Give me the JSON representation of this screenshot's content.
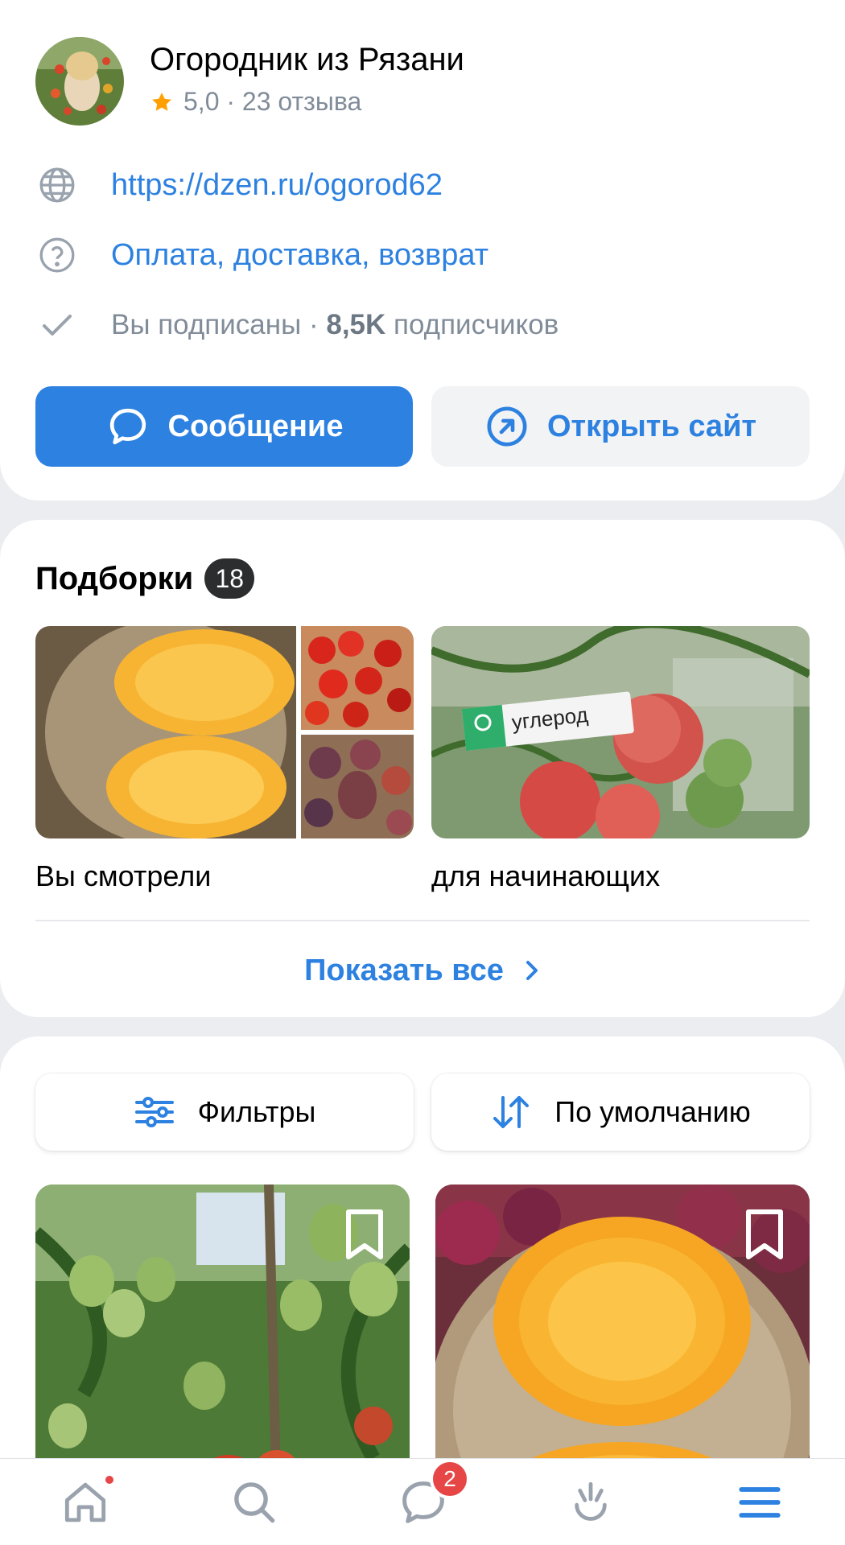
{
  "colors": {
    "accent": "#2D81E0",
    "muted_text": "#818C99",
    "background": "#EBEDF0",
    "badge_red": "#E64646",
    "icon_gray": "#99A2AD"
  },
  "profile": {
    "name": "Огородник из Рязани",
    "rating": "5,0",
    "rating_sep": " · ",
    "reviews": "23 отзыва"
  },
  "info": {
    "website": "https://dzen.ru/ogorod62",
    "policy": "Оплата, доставка, возврат",
    "subscribed": "Вы подписаны",
    "sep": " · ",
    "subscribers_count": "8,5K",
    "subscribers_word": " подписчиков"
  },
  "actions": {
    "message": "Сообщение",
    "open_site": "Открыть сайт"
  },
  "collections": {
    "title": "Подборки",
    "count": "18",
    "items": [
      {
        "label": "Вы смотрели"
      },
      {
        "label": "для начинающих",
        "overlay_tag": "углерод"
      }
    ],
    "show_all": "Показать все"
  },
  "products": {
    "filters_label": "Фильтры",
    "sort_label": "По умолчанию"
  },
  "tabbar": {
    "items": [
      {
        "icon": "home-icon",
        "notification_dot": true
      },
      {
        "icon": "search-icon"
      },
      {
        "icon": "messages-icon",
        "badge": "2"
      },
      {
        "icon": "services-icon"
      },
      {
        "icon": "menu-icon",
        "active": true
      }
    ]
  }
}
